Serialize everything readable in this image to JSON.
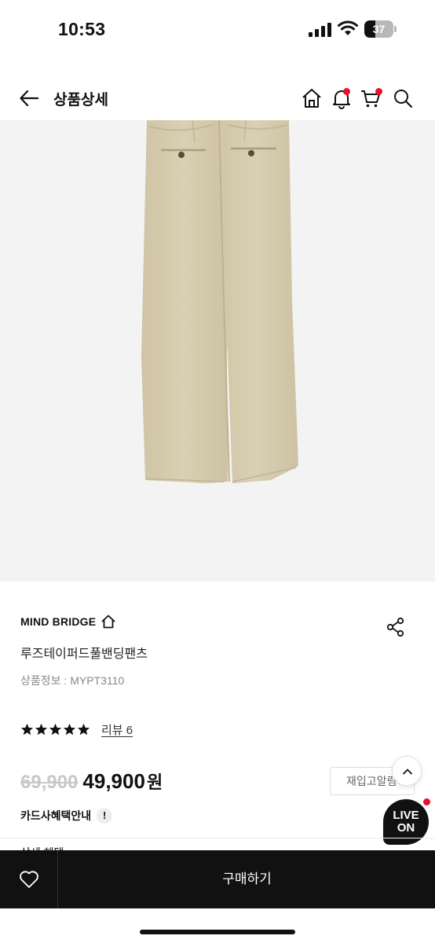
{
  "status_bar": {
    "time": "10:53",
    "battery_level": "37",
    "battery_fraction": 0.37,
    "icons": [
      "signal-icon",
      "wifi-icon",
      "battery-icon"
    ]
  },
  "header": {
    "title": "상품상세",
    "icons": [
      "back-arrow-icon",
      "home-icon",
      "bell-icon",
      "cart-icon",
      "search-icon"
    ],
    "badge_color": "#e8102a"
  },
  "product": {
    "image_alt_icon": "beige-pants-image",
    "brand": "MIND BRIDGE",
    "name": "루즈테이퍼드풀밴딩팬츠",
    "code": "상품정보 : MYPT3110",
    "rating_stars": 5,
    "review_label": "리뷰 6",
    "original_price": "69,900",
    "sale_price": "49,900",
    "price_unit": "원",
    "restock_label": "재입고알림",
    "card_benefit_label": "카드사혜택안내",
    "info_icon_symbol": "!",
    "peek_text": "상세 혜택"
  },
  "floating": {
    "live_label_line1": "LIVE",
    "live_label_line2": "ON"
  },
  "bottom_bar": {
    "buy_label": "구매하기",
    "wishlist_icon": "heart-icon"
  },
  "colors": {
    "accent": "#e8102a",
    "bar_background": "#111111",
    "pants": "#d6ccae"
  }
}
